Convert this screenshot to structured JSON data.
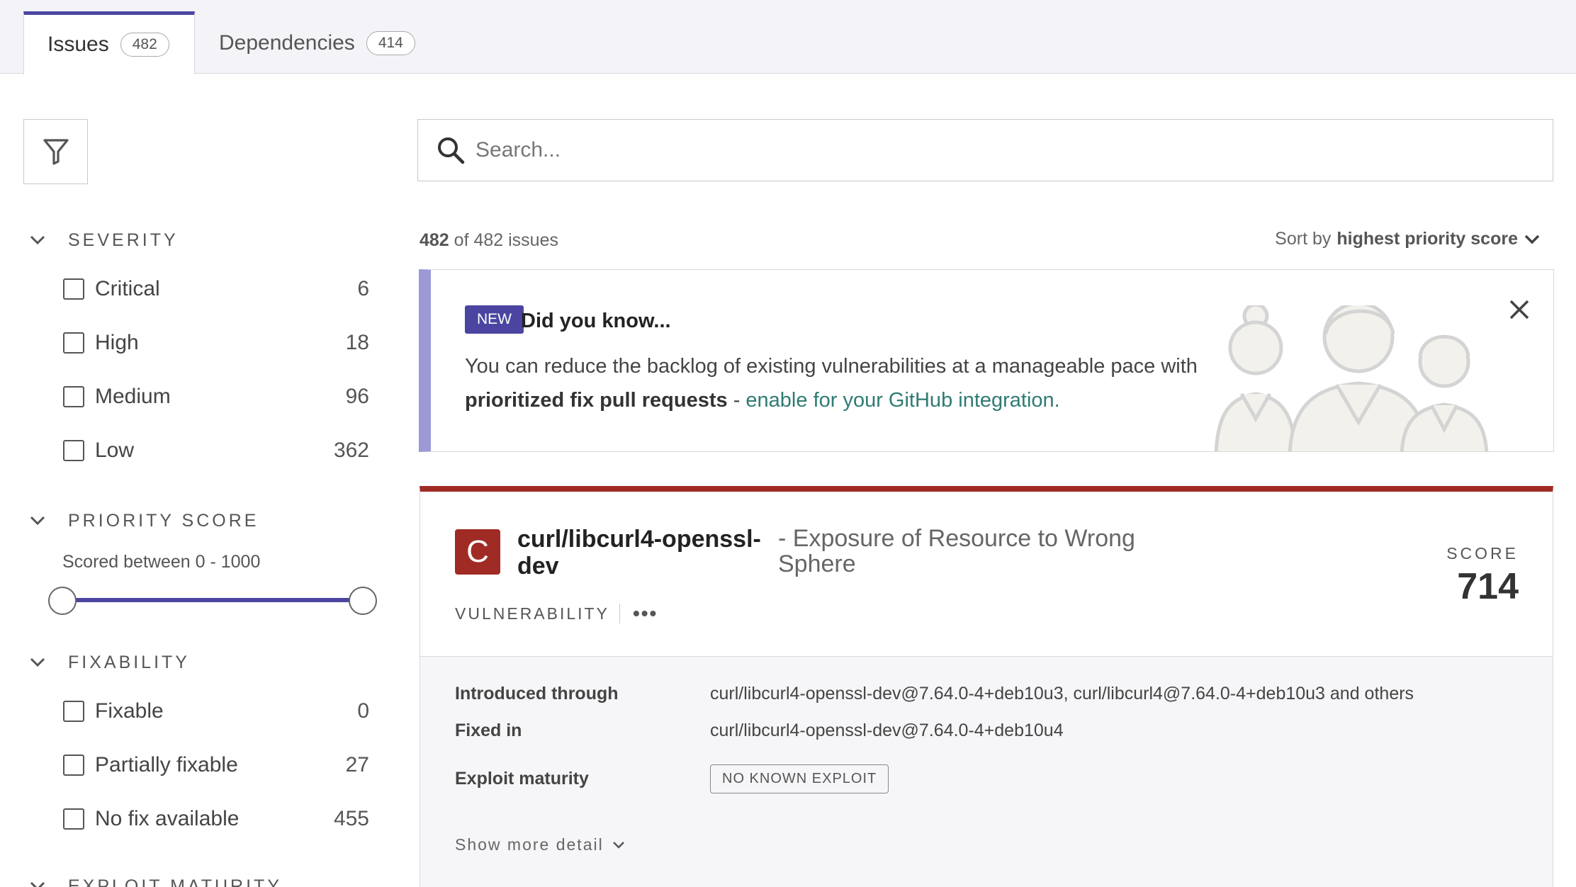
{
  "tabs": [
    {
      "label": "Issues",
      "count": "482"
    },
    {
      "label": "Dependencies",
      "count": "414"
    }
  ],
  "search": {
    "placeholder": "Search..."
  },
  "filters": {
    "severity": {
      "title": "SEVERITY",
      "items": [
        {
          "label": "Critical",
          "count": "6"
        },
        {
          "label": "High",
          "count": "18"
        },
        {
          "label": "Medium",
          "count": "96"
        },
        {
          "label": "Low",
          "count": "362"
        }
      ]
    },
    "priority": {
      "title": "PRIORITY SCORE",
      "range_text": "Scored between 0 - 1000",
      "range_min": 0,
      "range_max": 1000
    },
    "fixability": {
      "title": "FIXABILITY",
      "items": [
        {
          "label": "Fixable",
          "count": "0"
        },
        {
          "label": "Partially fixable",
          "count": "27"
        },
        {
          "label": "No fix available",
          "count": "455"
        }
      ]
    },
    "exploit": {
      "title": "EXPLOIT MATURITY"
    }
  },
  "results": {
    "shown": "482",
    "of_text": "of 482 issues",
    "sort_prefix": "Sort by",
    "sort_value": "highest priority score"
  },
  "banner": {
    "badge": "NEW",
    "title": "Did you know...",
    "text_1": "You can reduce the backlog of existing vulnerabilities at a manageable pace with",
    "text_bold": "prioritized fix pull requests",
    "text_sep": "-",
    "link": "enable for your GitHub integration."
  },
  "issue": {
    "severity_letter": "C",
    "package": "curl/libcurl4-openssl-dev",
    "title": "- Exposure of Resource to Wrong Sphere",
    "type": "VULNERABILITY",
    "more": "•••",
    "score_label": "SCORE",
    "score": "714",
    "introduced_label": "Introduced through",
    "introduced_value": "curl/libcurl4-openssl-dev@7.64.0-4+deb10u3, curl/libcurl4@7.64.0-4+deb10u3 and others",
    "fixed_label": "Fixed in",
    "fixed_value": "curl/libcurl4-openssl-dev@7.64.0-4+deb10u4",
    "exploit_label": "Exploit maturity",
    "exploit_value": "NO KNOWN EXPLOIT",
    "show_more": "Show more detail"
  },
  "colors": {
    "accent": "#4b45a1",
    "critical": "#a02b25",
    "link": "#2f7b74"
  }
}
